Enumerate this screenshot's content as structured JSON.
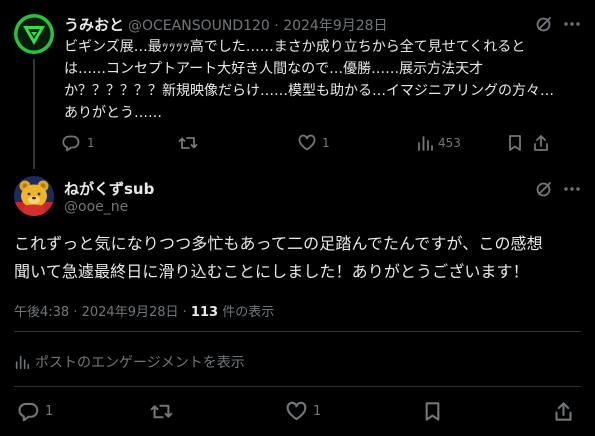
{
  "reply_post": {
    "display_name": "うみおと",
    "handle": "@OCEANSOUND120",
    "separator": " · ",
    "date": "2024年9月28日",
    "text": "ビギンズ展…最ｯｯｯｯ高でした……まさか成り立ちから全て見せてくれると\nは……コンセプトアート大好き人間なので…優勝……展示方法天才\nか？？？？？？新規映像だらけ……模型も助かる…イマジニアリングの方々…\nありがとう……",
    "actions": {
      "reply_count": "1",
      "repost_count": "",
      "like_count": "1",
      "view_count": "453"
    }
  },
  "main_post": {
    "display_name": "ねがくずsub",
    "handle": "@ooe_ne",
    "text": "これずっと気になりつつ多忙もあって二の足踏んでたんですが、この感想\n聞いて急遽最終日に滑り込むことにしました！ありがとうございます！",
    "time": "午後4:38",
    "date": "2024年9月28日",
    "views_number": "113",
    "views_label": " 件の表示",
    "engagement_label": "ポストのエンゲージメントを表示",
    "actions": {
      "reply_count": "1",
      "repost_count": "",
      "like_count": "1"
    }
  },
  "icons": {
    "reply": "comment-icon",
    "repost": "repost-icon",
    "like": "heart-icon",
    "views": "bar-chart-icon",
    "bookmark": "bookmark-icon",
    "share": "share-icon",
    "grok": "grok-icon",
    "more": "more-icon"
  },
  "colors": {
    "background": "#000000",
    "text": "#e7e9ea",
    "muted": "#71767b",
    "divider": "#2f3336",
    "avatar_accent": "#2ecc40"
  }
}
